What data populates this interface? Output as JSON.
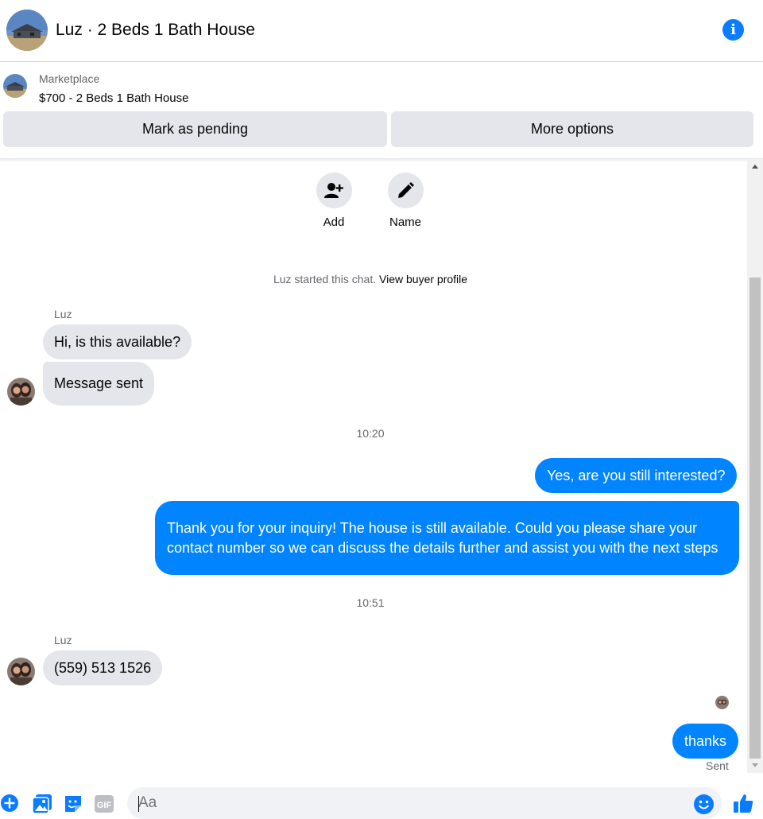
{
  "header": {
    "title": "Luz · 2 Beds 1 Bath House",
    "info_icon": "info-icon"
  },
  "listing": {
    "label": "Marketplace",
    "price_title": "$700 - 2 Beds 1 Bath House",
    "mark_pending": "Mark as pending",
    "more_options": "More options"
  },
  "actions": {
    "add": "Add",
    "name": "Name"
  },
  "system": {
    "started": "Luz started this chat.",
    "view_profile": "View buyer profile"
  },
  "messages": {
    "sender1": "Luz",
    "m1": "Hi, is this available?",
    "m2": "Message sent",
    "time1": "10:20",
    "m3": "Yes, are you still interested?",
    "m4": "Thank you for your inquiry! The house is still available. Could you please share your contact number so we can discuss the details further and assist you with the next steps",
    "time2": "10:51",
    "sender2": "Luz",
    "m5": "(559) 513 1526",
    "m6": "thanks",
    "status": "Sent"
  },
  "composer": {
    "placeholder": "Aa",
    "icons": [
      "plus-icon",
      "photo-icon",
      "sticker-icon",
      "gif-icon",
      "emoji-icon",
      "thumbs-up-icon"
    ],
    "gif_label": "GIF"
  },
  "colors": {
    "accent": "#0084ff",
    "icon_blue": "#0a7cff",
    "incoming_bubble": "#e4e6eb"
  }
}
